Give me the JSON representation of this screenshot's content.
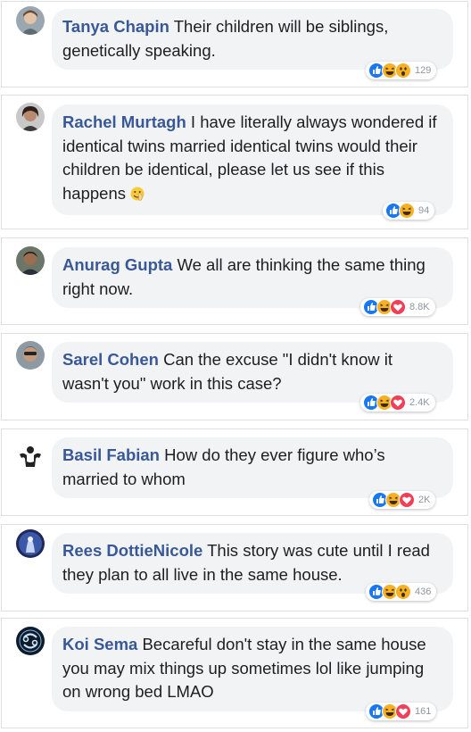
{
  "comments": [
    {
      "name": "Tanya Chapin",
      "text": "Their children will be siblings, genetically speaking.",
      "reactions": [
        "like-icon",
        "haha-icon",
        "wow-icon"
      ],
      "count": "129"
    },
    {
      "name": "Rachel Murtagh",
      "text": "I have literally always wondered if identical twins married identical twins would their children be identical, please let us see if this happens",
      "reactions": [
        "like-icon",
        "haha-icon"
      ],
      "count": "94"
    },
    {
      "name": "Anurag Gupta",
      "text": "We all are thinking the same thing right now.",
      "reactions": [
        "like-icon",
        "haha-icon",
        "love-icon"
      ],
      "count": "8.8K"
    },
    {
      "name": "Sarel Cohen",
      "text": "Can the excuse \"I didn't know it wasn't you\" work in this case?",
      "reactions": [
        "like-icon",
        "haha-icon",
        "love-icon"
      ],
      "count": "2.4K"
    },
    {
      "name": "Basil Fabian",
      "text": "How do they ever figure who’s married to whom",
      "reactions": [
        "like-icon",
        "haha-icon",
        "love-icon"
      ],
      "count": "2K"
    },
    {
      "name": "Rees DottieNicole",
      "text": "This story was cute until I read they plan to all live in the same house.",
      "reactions": [
        "like-icon",
        "haha-icon",
        "wow-icon"
      ],
      "count": "436"
    },
    {
      "name": "Koi Sema",
      "text": "Becareful don't stay in the same house you may mix things up sometimes lol like jumping on wrong bed LMAO",
      "reactions": [
        "like-icon",
        "haha-icon",
        "love-icon"
      ],
      "count": "161"
    }
  ],
  "colors": {
    "name": "#385898",
    "bubble": "#f2f3f5",
    "like": "#1877f2",
    "haha": "#f7b125",
    "love": "#f33e58",
    "count": "#90949c"
  }
}
